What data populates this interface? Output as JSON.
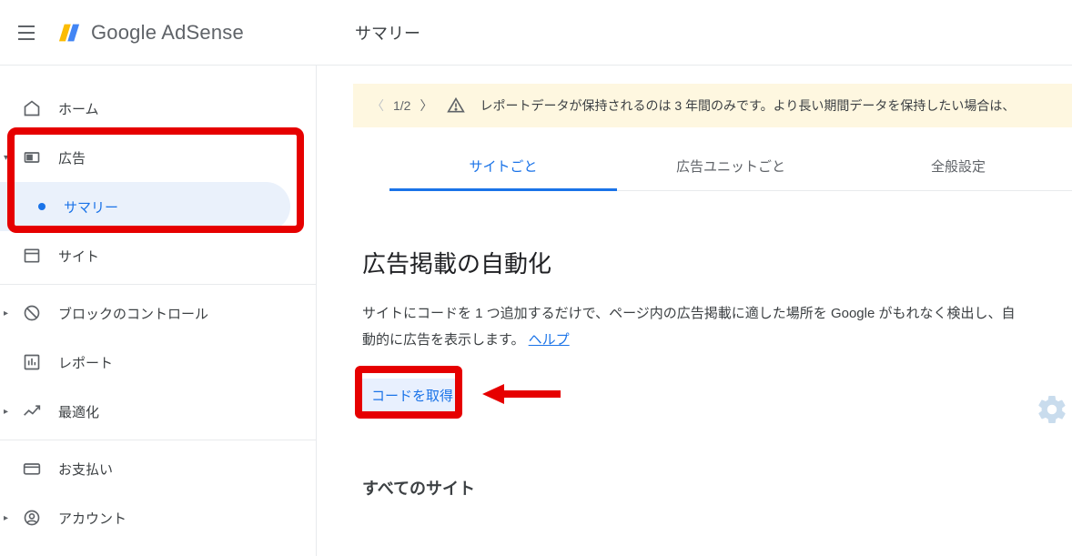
{
  "header": {
    "brand": "Google AdSense",
    "page_title": "サマリー"
  },
  "sidebar": {
    "items": [
      {
        "label": "ホーム",
        "icon": "home"
      },
      {
        "label": "広告",
        "icon": "ad",
        "expanded": true
      },
      {
        "label": "サマリー",
        "sub": true,
        "active": true
      },
      {
        "label": "サイト",
        "icon": "site"
      },
      {
        "label": "ブロックのコントロール",
        "icon": "block",
        "expandable": true
      },
      {
        "label": "レポート",
        "icon": "report"
      },
      {
        "label": "最適化",
        "icon": "optimize",
        "expandable": true
      },
      {
        "label": "お支払い",
        "icon": "payments"
      },
      {
        "label": "アカウント",
        "icon": "account",
        "expandable": true
      }
    ]
  },
  "notification": {
    "pager": "1/2",
    "message": "レポートデータが保持されるのは 3 年間のみです。より長い期間データを保持したい場合は、"
  },
  "tabs": [
    {
      "label": "サイトごと",
      "active": true
    },
    {
      "label": "広告ユニットごと"
    },
    {
      "label": "全般設定"
    }
  ],
  "main": {
    "heading": "広告掲載の自動化",
    "description_part1": "サイトにコードを 1 つ追加するだけで、ページ内の広告掲載に適した場所を Google がもれなく検出し、自動的に広告を表示します。 ",
    "help_label": "ヘルプ",
    "code_button": "コードを取得",
    "sub_heading": "すべてのサイト"
  }
}
